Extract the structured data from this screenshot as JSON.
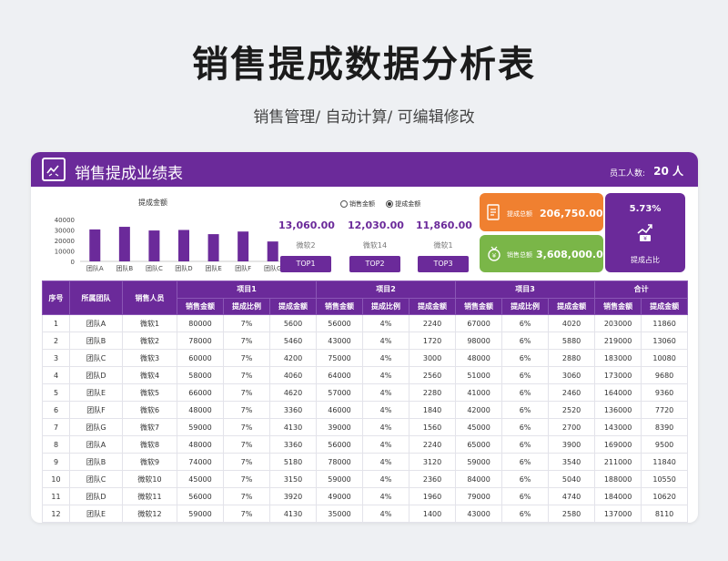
{
  "page": {
    "title": "销售提成数据分析表",
    "subtitle": "销售管理/ 自动计算/ 可编辑修改"
  },
  "header": {
    "title": "销售提成业绩表",
    "employee_label": "员工人数:",
    "employee_count": "20 人"
  },
  "chart_data": {
    "type": "bar",
    "title": "提成金额",
    "categories": [
      "团队A",
      "团队B",
      "团队C",
      "团队D",
      "团队E",
      "团队F",
      "团队G"
    ],
    "values": [
      30500,
      33000,
      29500,
      30000,
      26000,
      28500,
      19000
    ],
    "ylim": [
      0,
      40000
    ],
    "yticks": [
      "40000",
      "30000",
      "20000",
      "10000",
      "0"
    ],
    "bar_color": "#6b2a9a"
  },
  "toggle": {
    "option1": "销售金额",
    "option2": "提成金额"
  },
  "top": [
    {
      "amount": "13,060.00",
      "name": "微软2",
      "label": "TOP1"
    },
    {
      "amount": "12,030.00",
      "name": "微软14",
      "label": "TOP2"
    },
    {
      "amount": "11,860.00",
      "name": "微软1",
      "label": "TOP3"
    }
  ],
  "kpi": {
    "commission_label": "提成总额",
    "commission_value": "206,750.00",
    "sales_label": "销售总额",
    "sales_value": "3,608,000.00",
    "ratio_value": "5.73%",
    "ratio_label": "提成占比",
    "orange": "#f08030",
    "green": "#7ab648",
    "purple": "#6b2a9a"
  },
  "table": {
    "h_index": "序号",
    "h_team": "所属团队",
    "h_person": "销售人员",
    "groups": [
      "项目1",
      "项目2",
      "项目3",
      "合计"
    ],
    "sub_sales": "销售金额",
    "sub_ratio": "提成比例",
    "sub_comm": "提成金额",
    "rows": [
      [
        "1",
        "团队A",
        "微软1",
        "80000",
        "7%",
        "5600",
        "56000",
        "4%",
        "2240",
        "67000",
        "6%",
        "4020",
        "203000",
        "11860"
      ],
      [
        "2",
        "团队B",
        "微软2",
        "78000",
        "7%",
        "5460",
        "43000",
        "4%",
        "1720",
        "98000",
        "6%",
        "5880",
        "219000",
        "13060"
      ],
      [
        "3",
        "团队C",
        "微软3",
        "60000",
        "7%",
        "4200",
        "75000",
        "4%",
        "3000",
        "48000",
        "6%",
        "2880",
        "183000",
        "10080"
      ],
      [
        "4",
        "团队D",
        "微软4",
        "58000",
        "7%",
        "4060",
        "64000",
        "4%",
        "2560",
        "51000",
        "6%",
        "3060",
        "173000",
        "9680"
      ],
      [
        "5",
        "团队E",
        "微软5",
        "66000",
        "7%",
        "4620",
        "57000",
        "4%",
        "2280",
        "41000",
        "6%",
        "2460",
        "164000",
        "9360"
      ],
      [
        "6",
        "团队F",
        "微软6",
        "48000",
        "7%",
        "3360",
        "46000",
        "4%",
        "1840",
        "42000",
        "6%",
        "2520",
        "136000",
        "7720"
      ],
      [
        "7",
        "团队G",
        "微软7",
        "59000",
        "7%",
        "4130",
        "39000",
        "4%",
        "1560",
        "45000",
        "6%",
        "2700",
        "143000",
        "8390"
      ],
      [
        "8",
        "团队A",
        "微软8",
        "48000",
        "7%",
        "3360",
        "56000",
        "4%",
        "2240",
        "65000",
        "6%",
        "3900",
        "169000",
        "9500"
      ],
      [
        "9",
        "团队B",
        "微软9",
        "74000",
        "7%",
        "5180",
        "78000",
        "4%",
        "3120",
        "59000",
        "6%",
        "3540",
        "211000",
        "11840"
      ],
      [
        "10",
        "团队C",
        "微软10",
        "45000",
        "7%",
        "3150",
        "59000",
        "4%",
        "2360",
        "84000",
        "6%",
        "5040",
        "188000",
        "10550"
      ],
      [
        "11",
        "团队D",
        "微软11",
        "56000",
        "7%",
        "3920",
        "49000",
        "4%",
        "1960",
        "79000",
        "6%",
        "4740",
        "184000",
        "10620"
      ],
      [
        "12",
        "团队E",
        "微软12",
        "59000",
        "7%",
        "4130",
        "35000",
        "4%",
        "1400",
        "43000",
        "6%",
        "2580",
        "137000",
        "8110"
      ]
    ]
  }
}
